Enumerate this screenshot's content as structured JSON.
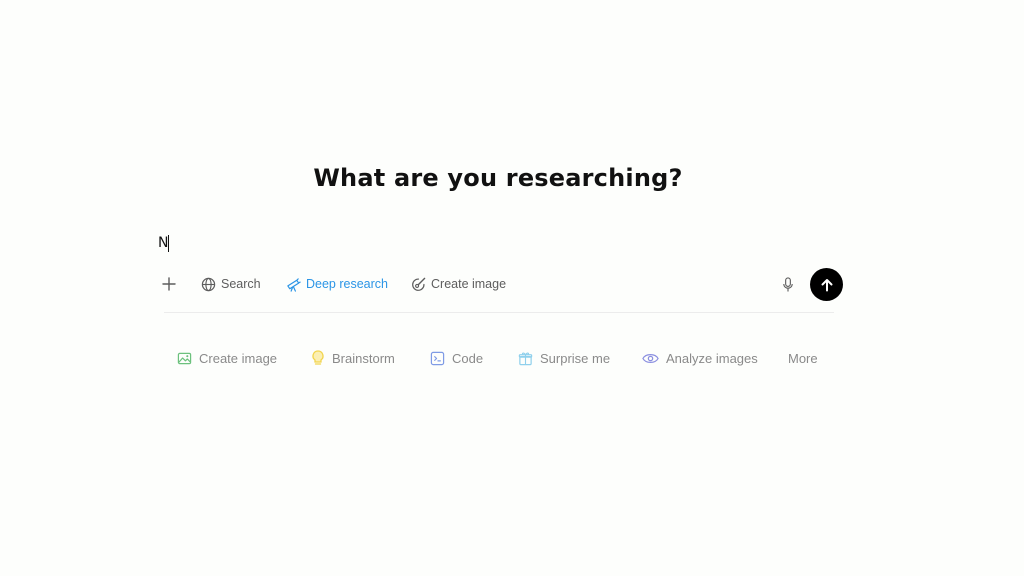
{
  "heading": "What are you researching?",
  "composer": {
    "input_value": "N"
  },
  "toolbar": {
    "search_label": "Search",
    "deep_research_label": "Deep research",
    "create_image_label": "Create image",
    "accent_color": "#2b95e6"
  },
  "suggestions": [
    {
      "label": "Create image",
      "icon": "image-icon",
      "color": "#6cc17d"
    },
    {
      "label": "Brainstorm",
      "icon": "lightbulb-icon",
      "color": "#f2d44c"
    },
    {
      "label": "Code",
      "icon": "code-icon",
      "color": "#7f9be5"
    },
    {
      "label": "Surprise me",
      "icon": "gift-icon",
      "color": "#8fd0ec"
    },
    {
      "label": "Analyze images",
      "icon": "eye-icon",
      "color": "#8b8fe0"
    },
    {
      "label": "More",
      "icon": "",
      "color": "#8a8a8a"
    }
  ]
}
